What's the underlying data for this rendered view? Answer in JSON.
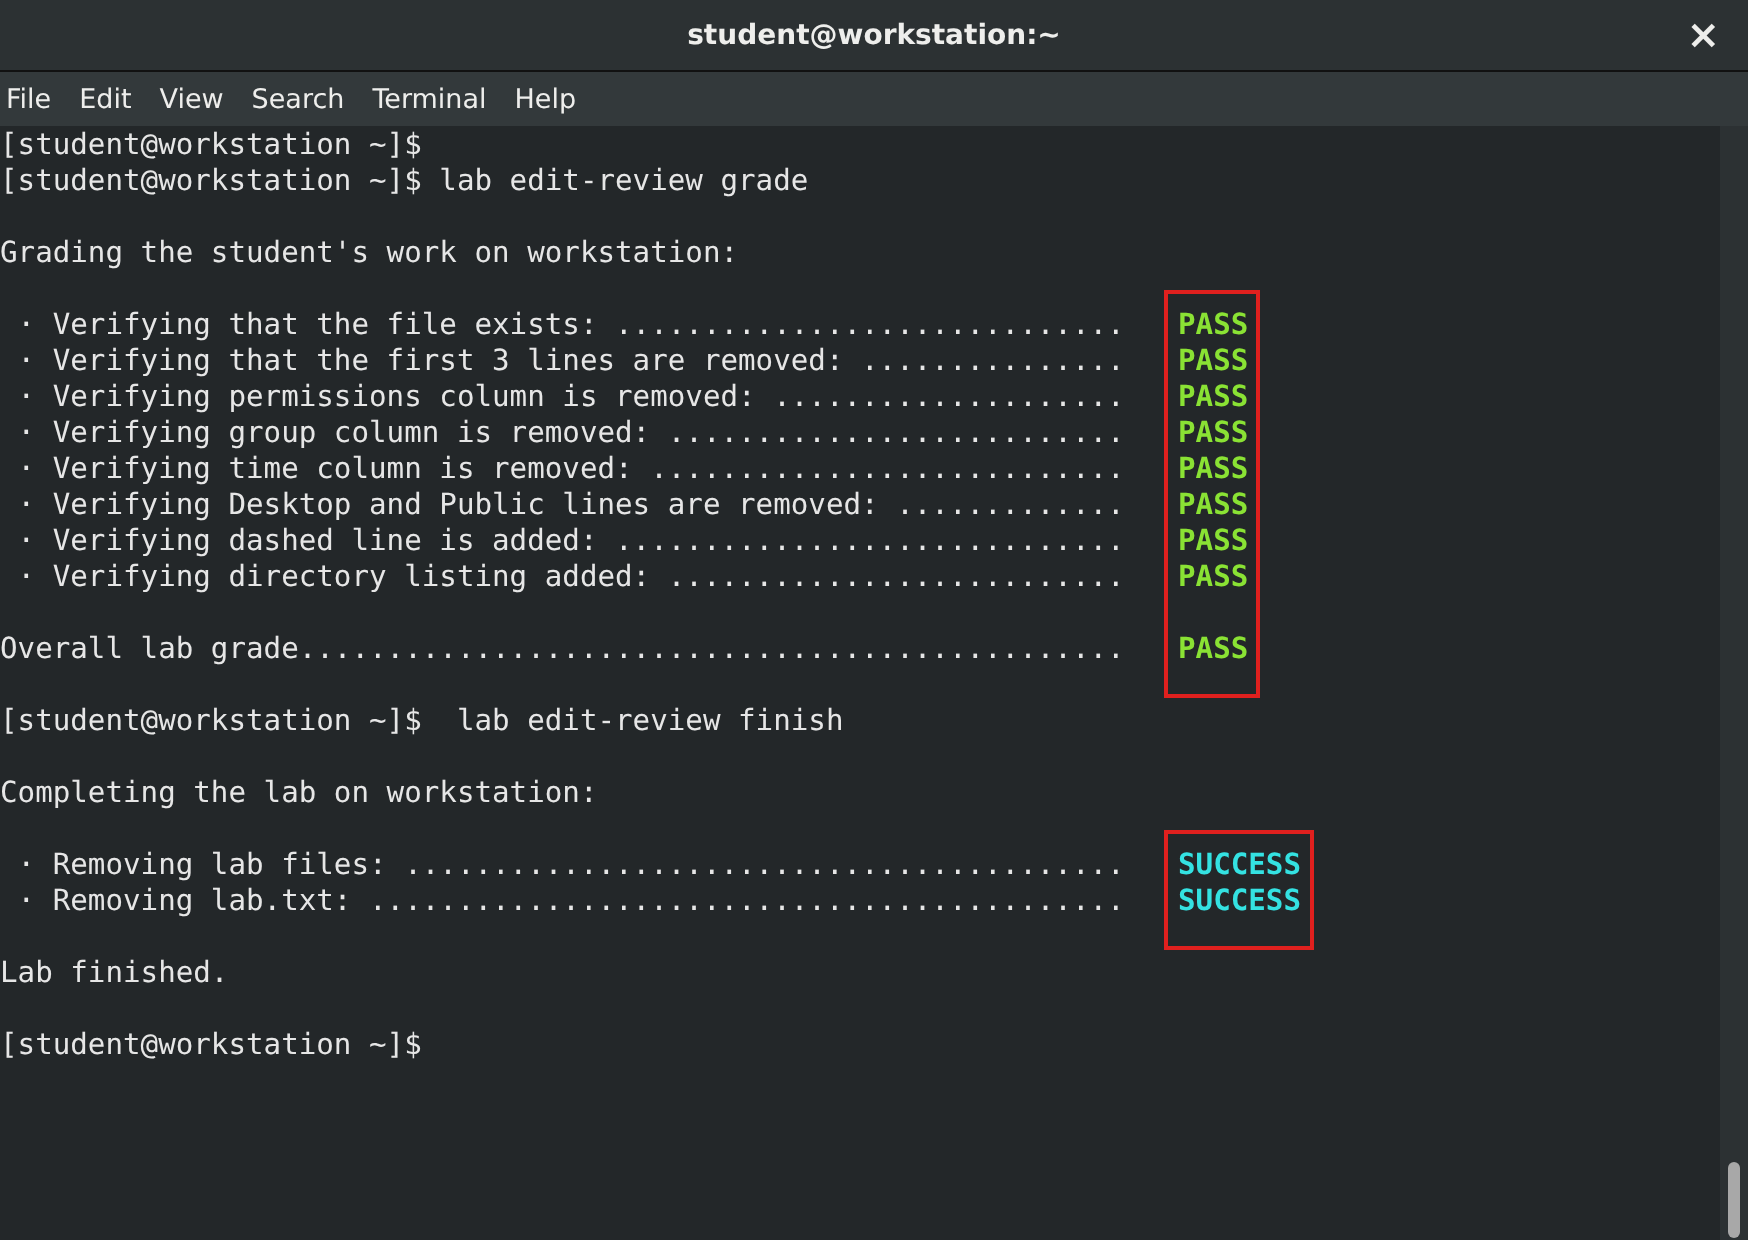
{
  "window": {
    "title": "student@workstation:~",
    "close": "×"
  },
  "menu": [
    "File",
    "Edit",
    "View",
    "Search",
    "Terminal",
    "Help"
  ],
  "sections": [
    {
      "kind": "text",
      "lines": [
        {
          "kind": "text",
          "text": "[student@workstation ~]$"
        },
        {
          "kind": "text",
          "text": "[student@workstation ~]$ lab edit-review grade"
        },
        {
          "kind": "blank"
        },
        {
          "kind": "text",
          "text": "Grading the student's work on workstation:"
        },
        {
          "kind": "blank"
        }
      ]
    },
    {
      "kind": "results",
      "highlighted": true,
      "rows": [
        {
          "kind": "check",
          "label": " · Verifying that the file exists: .............................",
          "result": "PASS",
          "color": "#8ae234"
        },
        {
          "kind": "check",
          "label": " · Verifying that the first 3 lines are removed: ...............",
          "result": "PASS",
          "color": "#8ae234"
        },
        {
          "kind": "check",
          "label": " · Verifying permissions column is removed: ....................",
          "result": "PASS",
          "color": "#8ae234"
        },
        {
          "kind": "check",
          "label": " · Verifying group column is removed: ..........................",
          "result": "PASS",
          "color": "#8ae234"
        },
        {
          "kind": "check",
          "label": " · Verifying time column is removed: ...........................",
          "result": "PASS",
          "color": "#8ae234"
        },
        {
          "kind": "check",
          "label": " · Verifying Desktop and Public lines are removed: .............",
          "result": "PASS",
          "color": "#8ae234"
        },
        {
          "kind": "check",
          "label": " · Verifying dashed line is added: .............................",
          "result": "PASS",
          "color": "#8ae234"
        },
        {
          "kind": "check",
          "label": " · Verifying directory listing added: ..........................",
          "result": "PASS",
          "color": "#8ae234"
        },
        {
          "kind": "blank"
        },
        {
          "kind": "check",
          "label": "Overall lab grade...............................................",
          "result": "PASS",
          "color": "#8ae234"
        }
      ]
    },
    {
      "kind": "text",
      "lines": [
        {
          "kind": "blank"
        },
        {
          "kind": "text",
          "text": "[student@workstation ~]$  lab edit-review finish"
        },
        {
          "kind": "blank"
        },
        {
          "kind": "text",
          "text": "Completing the lab on workstation:"
        },
        {
          "kind": "blank"
        }
      ]
    },
    {
      "kind": "results",
      "highlighted": true,
      "rows": [
        {
          "kind": "check",
          "label": " · Removing lab files: .........................................",
          "result": "SUCCESS",
          "color": "#34e2e2"
        },
        {
          "kind": "check",
          "label": " · Removing lab.txt: ...........................................",
          "result": "SUCCESS",
          "color": "#34e2e2"
        }
      ]
    },
    {
      "kind": "text",
      "lines": [
        {
          "kind": "blank"
        },
        {
          "kind": "text",
          "text": "Lab finished."
        },
        {
          "kind": "blank"
        },
        {
          "kind": "text",
          "text": "[student@workstation ~]$"
        }
      ]
    }
  ]
}
